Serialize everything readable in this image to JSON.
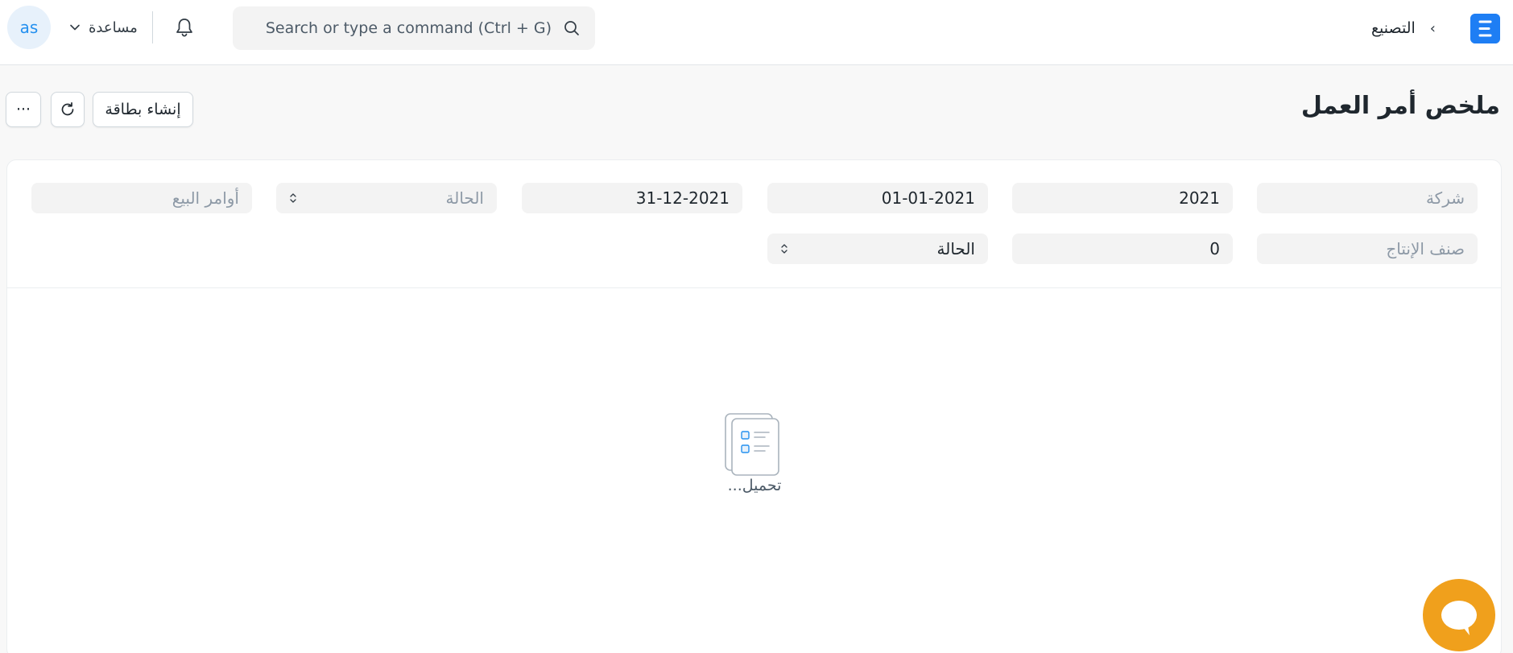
{
  "navbar": {
    "avatar_initials": "as",
    "help_label": "مساعدة",
    "search_placeholder": "Search or type a command (Ctrl + G)",
    "breadcrumb_module": "التصنيع",
    "breadcrumb_separator": "›"
  },
  "page": {
    "title": "ملخص أمر العمل",
    "create_card_label": "إنشاء بطاقة",
    "more_label": "···"
  },
  "filters": {
    "company_placeholder": "شركة",
    "fiscal_year": "2021",
    "from_date": "01-01-2021",
    "to_date": "31-12-2021",
    "status_placeholder": "الحالة",
    "sales_orders_placeholder": "أوامر البيع",
    "production_item_placeholder": "صنف الإنتاج",
    "age": "0",
    "charts_based_on": "الحالة"
  },
  "loading_text": "تحميل...",
  "colors": {
    "brand": "#1e7ef4",
    "avatar_text": "#2490ef",
    "chat_bubble": "#f0a01c"
  }
}
